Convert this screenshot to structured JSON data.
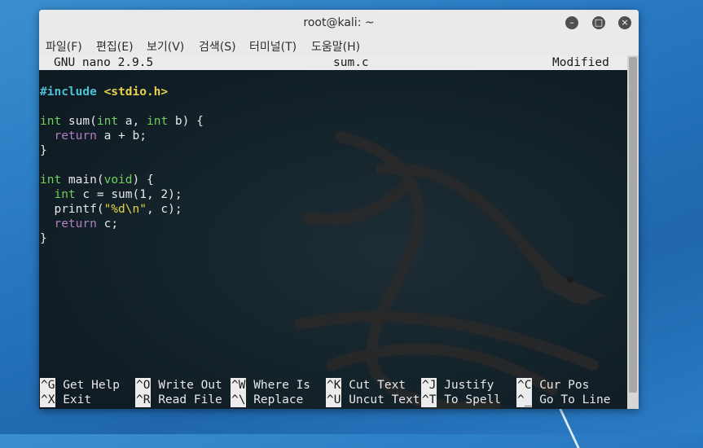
{
  "window": {
    "title": "root@kali: ~",
    "menu": [
      "파일(F)",
      "편집(E)",
      "보기(V)",
      "검색(S)",
      "터미널(T)",
      "도움말(H)"
    ]
  },
  "nano": {
    "version": "GNU nano 2.9.5",
    "filename": "sum.c",
    "status": "Modified"
  },
  "code": {
    "l1_pp": "#include",
    "l1_inc": "<stdio.h>",
    "l3_type1": "int",
    "l3_name": " sum(",
    "l3_type2": "int",
    "l3_a": " a, ",
    "l3_type3": "int",
    "l3_b": " b) {",
    "l4_indent": "  ",
    "l4_kw": "return",
    "l4_rest": " a + b;",
    "l5": "}",
    "l7_type": "int",
    "l7_name": " main(",
    "l7_void": "void",
    "l7_rest": ") {",
    "l8_indent": "  ",
    "l8_type": "int",
    "l8_rest": " c = sum(1, 2);",
    "l9_a": "  printf(",
    "l9_str": "\"%d\\n\"",
    "l9_b": ", c);",
    "l10_indent": "  ",
    "l10_kw": "return",
    "l10_rest": " c;",
    "l11": "}"
  },
  "shortcuts": [
    {
      "key": "^G",
      "label": "Get Help"
    },
    {
      "key": "^O",
      "label": "Write Out"
    },
    {
      "key": "^W",
      "label": "Where Is"
    },
    {
      "key": "^K",
      "label": "Cut Text"
    },
    {
      "key": "^J",
      "label": "Justify"
    },
    {
      "key": "^C",
      "label": "Cur Pos"
    },
    {
      "key": "^X",
      "label": "Exit"
    },
    {
      "key": "^R",
      "label": "Read File"
    },
    {
      "key": "^\\",
      "label": "Replace"
    },
    {
      "key": "^U",
      "label": "Uncut Text"
    },
    {
      "key": "^T",
      "label": "To Spell"
    },
    {
      "key": "^_",
      "label": "Go To Line"
    }
  ]
}
